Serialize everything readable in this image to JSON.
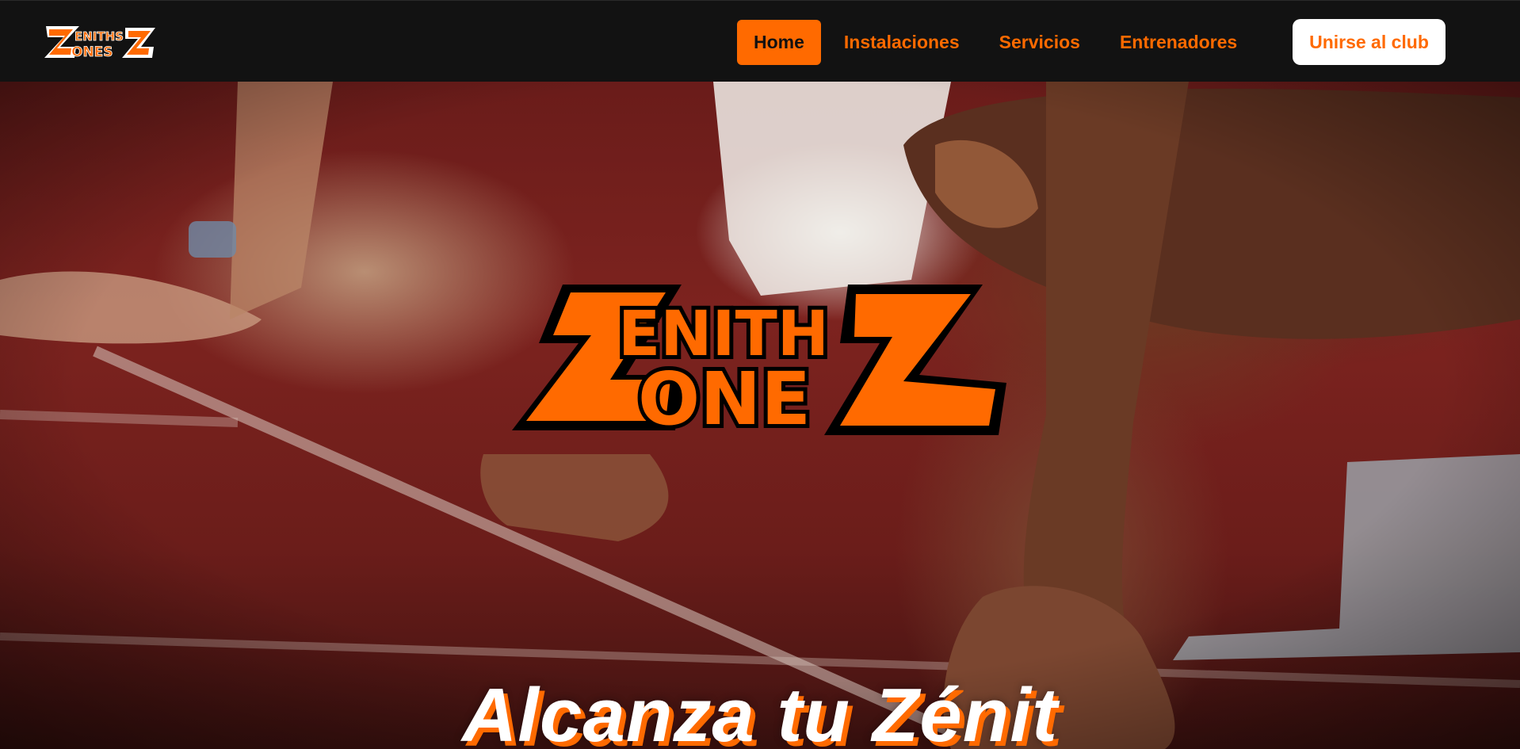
{
  "brand": {
    "logo_text": "ZENITHS ZONES",
    "accent": "#ff6a00",
    "nav_bg": "#121212"
  },
  "nav": {
    "links": [
      {
        "label": "Home",
        "active": true
      },
      {
        "label": "Instalaciones",
        "active": false
      },
      {
        "label": "Servicios",
        "active": false
      },
      {
        "label": "Entrenadores",
        "active": false
      }
    ],
    "cta_label": "Unirse al club"
  },
  "hero": {
    "background": "sprinters-starting-blocks-photo",
    "title": "Alcanza tu Zénit"
  }
}
